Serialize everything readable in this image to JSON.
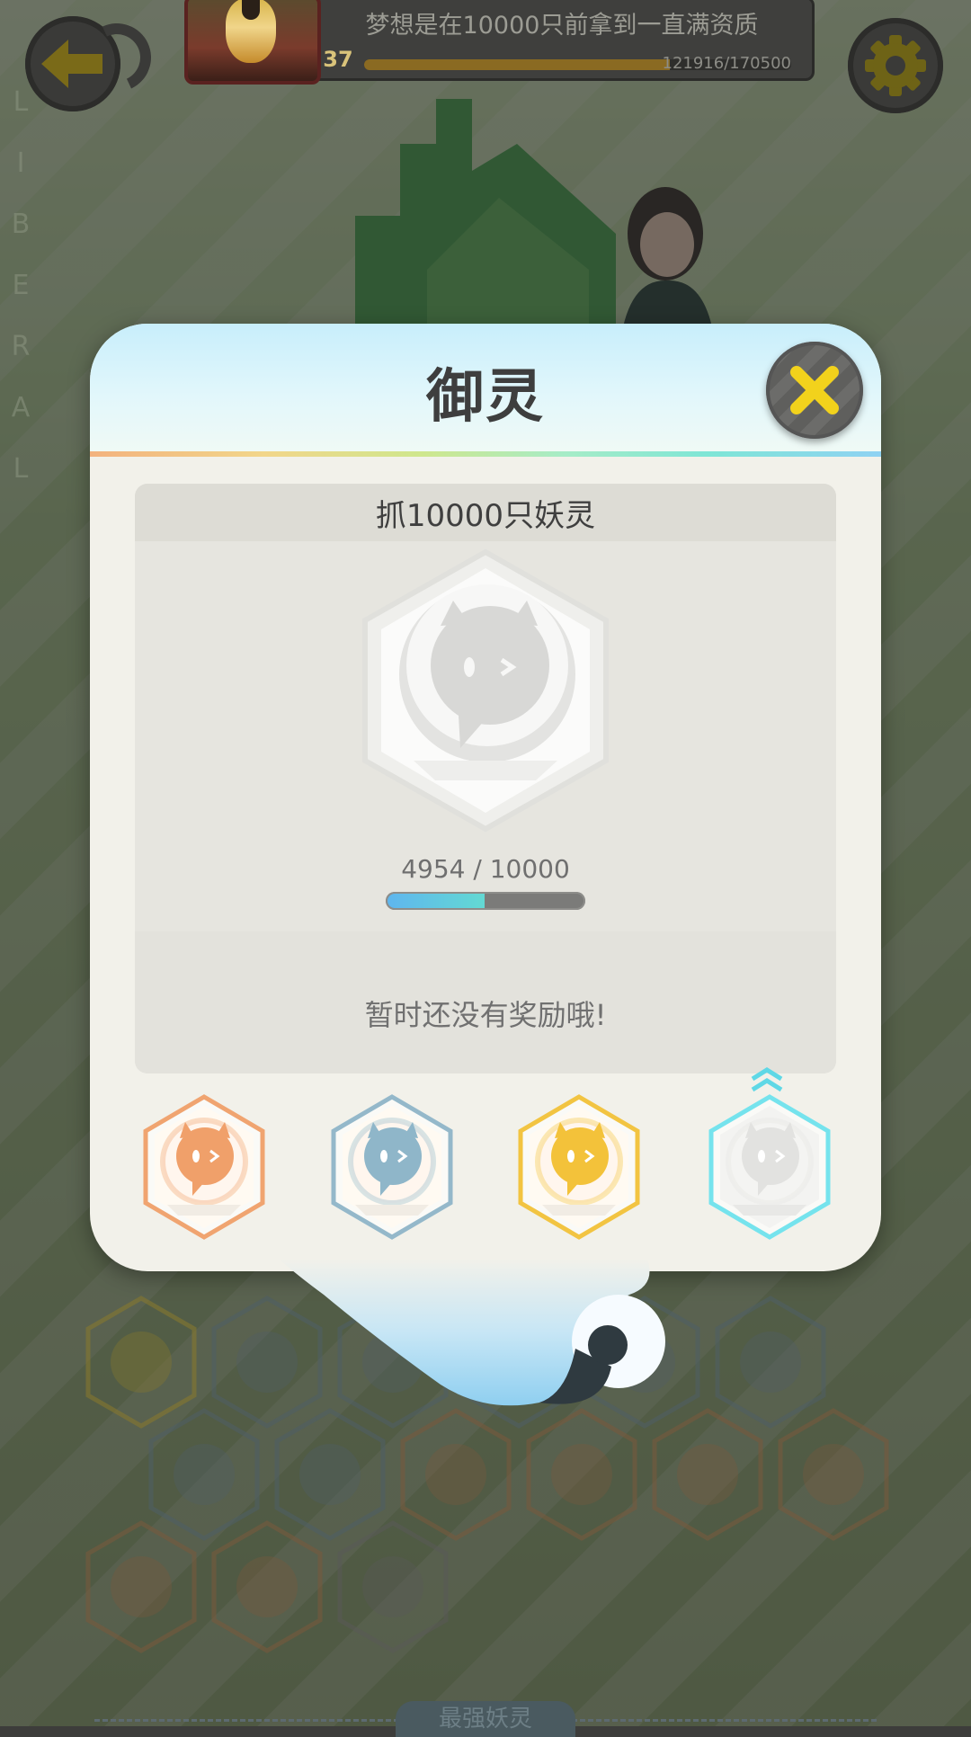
{
  "header": {
    "motto": "梦想是在10000只前拿到一直满资质",
    "level": "37",
    "exp_text": "121916/170500",
    "exp_ratio": 0.715
  },
  "side_text": [
    "L",
    "I",
    "B",
    "E",
    "R",
    "A",
    "L"
  ],
  "modal": {
    "title": "御灵",
    "task": {
      "title": "抓10000只妖灵",
      "progress_text": "4954 / 10000",
      "current": 4954,
      "target": 10000
    },
    "reward_text": "暂时还没有奖励哦!",
    "tiers": [
      {
        "name": "bronze",
        "color": "#f0a06a",
        "state": "earned"
      },
      {
        "name": "silver",
        "color": "#8fb6c9",
        "state": "earned"
      },
      {
        "name": "gold",
        "color": "#f3c23a",
        "state": "earned"
      },
      {
        "name": "platinum",
        "color": "#6fe3ee",
        "state": "current"
      }
    ]
  },
  "bottom_tab": "最强妖灵",
  "colors": {
    "accent_yellow": "#f2d21c",
    "progress_blue": "#5fb6ee",
    "progress_teal": "#63d9d3"
  }
}
